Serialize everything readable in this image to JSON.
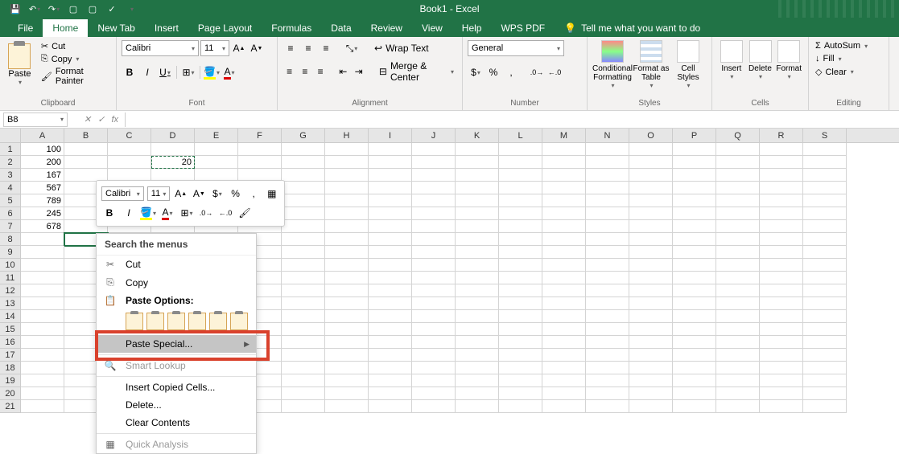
{
  "title": "Book1  -  Excel",
  "qat": [
    "save",
    "undo",
    "redo"
  ],
  "tabs": [
    "File",
    "Home",
    "New Tab",
    "Insert",
    "Page Layout",
    "Formulas",
    "Data",
    "Review",
    "View",
    "Help",
    "WPS PDF"
  ],
  "tell_me": "Tell me what you want to do",
  "clipboard": {
    "paste": "Paste",
    "cut": "Cut",
    "copy": "Copy",
    "fmt_painter": "Format Painter",
    "label": "Clipboard"
  },
  "font": {
    "name": "Calibri",
    "size": "11",
    "label": "Font"
  },
  "alignment": {
    "wrap": "Wrap Text",
    "merge": "Merge & Center",
    "label": "Alignment"
  },
  "number": {
    "format": "General",
    "label": "Number"
  },
  "styles": {
    "cond": "Conditional Formatting",
    "table": "Format as Table",
    "cell": "Cell Styles",
    "label": "Styles"
  },
  "cells": {
    "insert": "Insert",
    "delete": "Delete",
    "format": "Format",
    "label": "Cells"
  },
  "editing": {
    "autosum": "AutoSum",
    "fill": "Fill",
    "clear": "Clear",
    "label": "Editing"
  },
  "name_box": "B8",
  "cols": [
    "A",
    "B",
    "C",
    "D",
    "E",
    "F",
    "G",
    "H",
    "I",
    "J",
    "K",
    "L",
    "M",
    "N",
    "O",
    "P",
    "Q",
    "R",
    "S"
  ],
  "row_count": 21,
  "a_values": [
    "100",
    "200",
    "167",
    "567",
    "789",
    "245",
    "678"
  ],
  "d2_value": "20",
  "mini": {
    "font": "Calibri",
    "size": "11"
  },
  "ctx": {
    "search": "Search the menus",
    "cut": "Cut",
    "copy": "Copy",
    "paste_options": "Paste Options:",
    "paste_special": "Paste Special...",
    "smart_lookup": "Smart Lookup",
    "insert_copied": "Insert Copied Cells...",
    "delete": "Delete...",
    "clear": "Clear Contents",
    "quick": "Quick Analysis"
  }
}
